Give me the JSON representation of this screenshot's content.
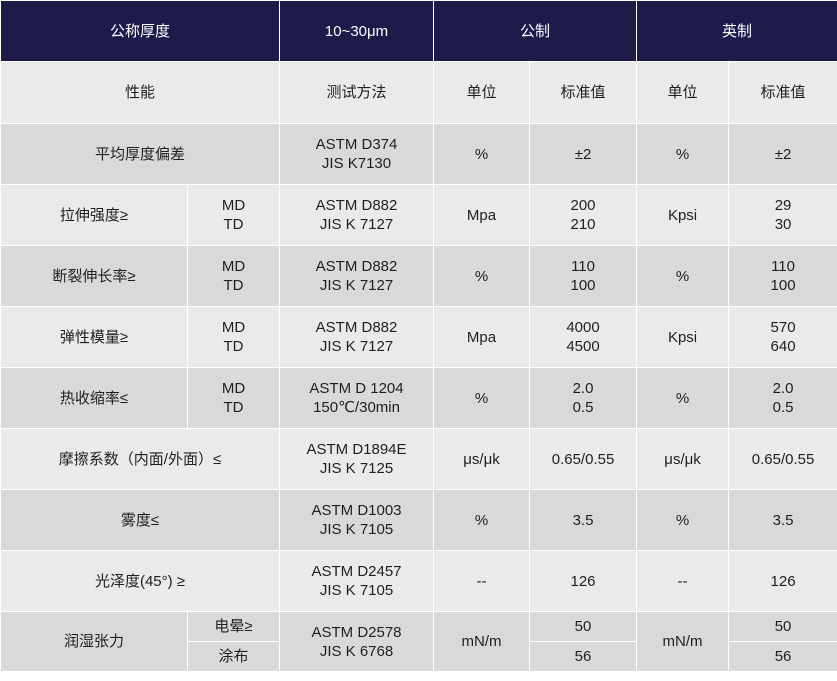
{
  "header": {
    "col1": "公称厚度",
    "col2": "10~30μm",
    "metric": "公制",
    "imperial": "英制"
  },
  "subheader": {
    "property": "性能",
    "method": "测试方法",
    "metric_unit": "单位",
    "metric_value": "标准值",
    "imperial_unit": "单位",
    "imperial_value": "标准值"
  },
  "rows": [
    {
      "property": "平均厚度偏差",
      "direction": "",
      "method": "ASTM D374\nJIS K7130",
      "metric_unit": "%",
      "metric_value": "±2",
      "imperial_unit": "%",
      "imperial_value": "±2"
    },
    {
      "property": "拉伸强度≥",
      "direction": "MD\nTD",
      "method": "ASTM D882\nJIS K 7127",
      "metric_unit": "Mpa",
      "metric_value": "200\n210",
      "imperial_unit": "Kpsi",
      "imperial_value": "29\n30"
    },
    {
      "property": "断裂伸长率≥",
      "direction": "MD\nTD",
      "method": "ASTM D882\nJIS K 7127",
      "metric_unit": "%",
      "metric_value": "110\n100",
      "imperial_unit": "%",
      "imperial_value": "110\n100"
    },
    {
      "property": "弹性模量≥",
      "direction": "MD\nTD",
      "method": "ASTM D882\nJIS K 7127",
      "metric_unit": "Mpa",
      "metric_value": "4000\n4500",
      "imperial_unit": "Kpsi",
      "imperial_value": "570\n640"
    },
    {
      "property": "热收缩率≤",
      "direction": "MD\nTD",
      "method": "ASTM D 1204\n150℃/30min",
      "metric_unit": "%",
      "metric_value": "2.0\n0.5",
      "imperial_unit": "%",
      "imperial_value": "2.0\n0.5"
    },
    {
      "property": "摩擦系数（内面/外面）≤",
      "direction": "",
      "method": "ASTM D1894E\nJIS K 7125",
      "metric_unit": "μs/μk",
      "metric_value": "0.65/0.55",
      "imperial_unit": "μs/μk",
      "imperial_value": "0.65/0.55"
    },
    {
      "property": "雾度≤",
      "direction": "",
      "method": "ASTM D1003\nJIS K 7105",
      "metric_unit": "%",
      "metric_value": "3.5",
      "imperial_unit": "%",
      "imperial_value": "3.5"
    },
    {
      "property": "光泽度(45°) ≥",
      "direction": "",
      "method": "ASTM D2457\nJIS K 7105",
      "metric_unit": "--",
      "metric_value": "126",
      "imperial_unit": "--",
      "imperial_value": "126"
    }
  ],
  "wetting": {
    "property": "润湿张力",
    "corona": "电晕≥",
    "coated": "涂布",
    "method": "ASTM D2578\nJIS K 6768",
    "metric_unit": "mN/m",
    "metric_corona": "50",
    "metric_coated": "56",
    "imperial_unit": "mN/m",
    "imperial_corona": "50",
    "imperial_coated": "56"
  },
  "colors": {
    "header_bg": "#1e1b4b",
    "band_light": "#eaeaea",
    "band_dark": "#d9d9d9"
  }
}
